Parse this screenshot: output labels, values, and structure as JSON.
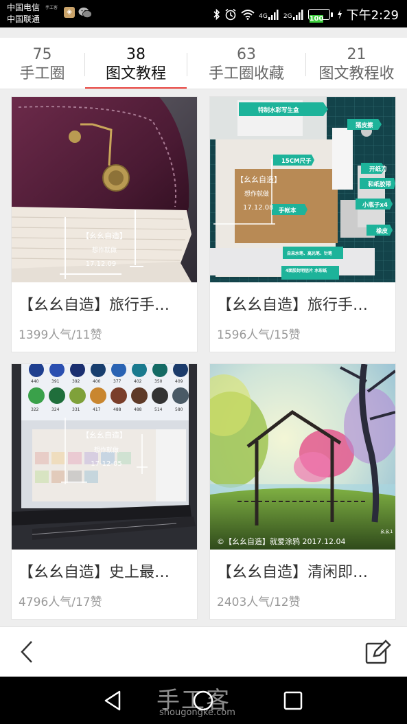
{
  "status_bar": {
    "carrier_1": "中国电信",
    "carrier_2": "中国联通",
    "tiny_note": "手工客",
    "network_1": "4G",
    "network_2": "2G",
    "battery": "100",
    "time": "下午2:29"
  },
  "tabs": [
    {
      "count": "75",
      "label": "手工圈",
      "active": false
    },
    {
      "count": "38",
      "label": "图文教程",
      "active": true
    },
    {
      "count": "63",
      "label": "手工圈收藏",
      "active": false
    },
    {
      "count": "21",
      "label": "图文教程收",
      "active": false
    }
  ],
  "cards": [
    {
      "title": "【幺幺自造】旅行手…",
      "stats": "1399人气/11赞",
      "thumb_text": {
        "brand": "【幺幺自造】",
        "sub": "想作就做",
        "date": "17.12.09"
      }
    },
    {
      "title": "【幺幺自造】旅行手…",
      "stats": "1596人气/15赞",
      "thumb_text": {
        "brand": "【幺幺自造】",
        "sub": "想作就做",
        "date": "17.12.08",
        "tags": [
          "特制水彩写生盒",
          "猪皮擦",
          "15CM尺子",
          "开纸刀",
          "和纸胶带",
          "手帐本",
          "小瓶子x4",
          "橡皮",
          "自来水笔、高光笔、针笔",
          "4面胶封明信片 水彩纸"
        ]
      }
    },
    {
      "title": "【幺幺自造】史上最…",
      "stats": "4796人气/17赞",
      "thumb_text": {
        "brand": "【幺幺自造】",
        "sub": "想作就做",
        "date": "17-12-05",
        "swatch_row1": [
          "440",
          "391",
          "392",
          "400",
          "377",
          "402",
          "350",
          "409"
        ],
        "swatch_row2": [
          "322",
          "324",
          "331",
          "417",
          "488",
          "488",
          "514",
          "580"
        ]
      }
    },
    {
      "title": "【幺幺自造】清闲即…",
      "stats": "2403人气/12赞",
      "thumb_text": {
        "caption": "©【幺幺自造】就爱涂鸦 2017.12.04",
        "corner": "幺幺1"
      }
    }
  ],
  "watermark": {
    "main": "手工客",
    "sub": "shougongke.com"
  },
  "icons": {
    "back": "chevron-left-icon",
    "edit": "edit-icon",
    "nav_back": "triangle-back-icon",
    "nav_home": "circle-home-icon",
    "nav_recent": "square-recent-icon"
  },
  "colors": {
    "accent": "#e8433e",
    "tab_active": "#111111",
    "text_muted": "#999999"
  }
}
